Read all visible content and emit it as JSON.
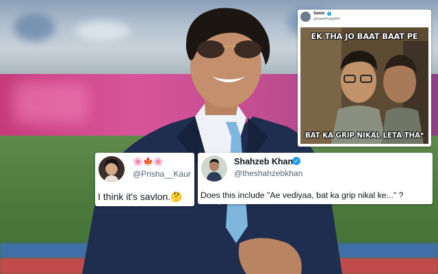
{
  "background": {
    "colors": {
      "stand": "#b4c2d0",
      "ad_board": "#d8549a",
      "field": "#4f7d3e",
      "rope": "#3f6fa6",
      "boundary": "#c14b4a",
      "blazer": "#1f2d4f",
      "tie": "#7fb6de"
    }
  },
  "tweets": {
    "meme_tweet": {
      "name": "Samir",
      "handle": "@SamirPuligWhf",
      "meme": {
        "top_caption": "EK THA JO BAAT BAAT PE",
        "bottom_caption": "BAT KA GRIP NIKAL LETA THA*"
      }
    },
    "prisha": {
      "flags": "🌸🍁🌸",
      "handle": "@Prisha__Kaur",
      "text": "I think it's savlon.🤔"
    },
    "shahzeb": {
      "name": "Shahzeb Khan",
      "handle": "@theshahzebkhan",
      "text": "Does this include \"Ae vediyaa, bat ka grip nikal ke...\" ?"
    }
  },
  "icons": {
    "verified": "verified-badge-icon",
    "tweet_avatar": "avatar"
  }
}
